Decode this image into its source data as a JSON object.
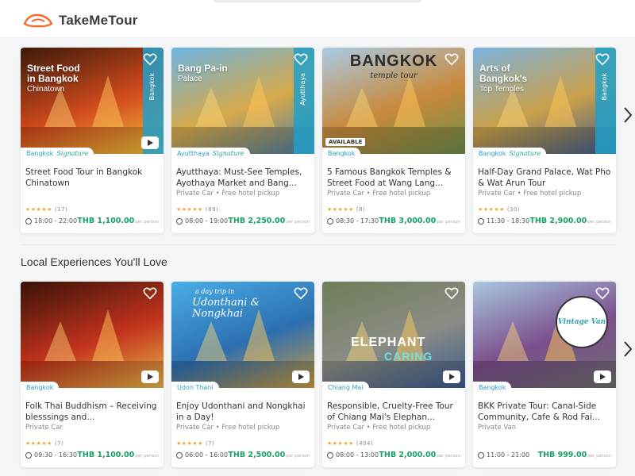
{
  "brand": {
    "name": "TakeMeTour"
  },
  "section2_title": "Local Experiences You'll Love",
  "per_person_label": "per person",
  "row1": [
    {
      "img_title_line1": "Street Food",
      "img_title_line2": "in Bangkok",
      "img_title_line3": "Chinatown",
      "band": "Bangkok",
      "location": "Bangkok",
      "signature": "Signature",
      "title": "Street Food Tour in Bangkok Chinatown",
      "transport": "",
      "stars": "★★★★★",
      "reviews": "(17)",
      "time": "18:00 - 22:00",
      "price": "THB 1,100.00",
      "colors": [
        "#3c1a0a",
        "#d24b1d",
        "#f3c43a"
      ]
    },
    {
      "img_title_line1": "Bang Pa-in",
      "img_title_line2": "",
      "img_title_line3": "Palace",
      "band": "Ayutthaya",
      "location": "Ayutthaya",
      "signature": "Signature",
      "title": "Ayutthaya: Must-See Temples, Ayothaya Market and Bang...",
      "transport": "Private Car • Free hotel pickup",
      "stars": "★★★★★",
      "reviews": "(89)",
      "time": "08:00 - 19:00",
      "price": "THB 2,250.00",
      "colors": [
        "#6bb5e3",
        "#d7a94a",
        "#4b7da3"
      ]
    },
    {
      "img_title_line1": "BANGKOK",
      "img_title_line2": "temple tour",
      "img_title_line3": "",
      "band": "",
      "location": "Bangkok",
      "signature": "",
      "title": "5 Famous Bangkok Temples & Street Food at Wang Lang...",
      "transport": "Private Car • Free hotel pickup",
      "stars": "★★★★★",
      "reviews": "(8)",
      "time": "08:30 - 17:30",
      "price": "THB 3,000.00",
      "badge": "AVAILABLE",
      "colors": [
        "#a9cbe6",
        "#c8893b",
        "#6b8f4a"
      ]
    },
    {
      "img_title_line1": "Arts of",
      "img_title_line2": "Bangkok's",
      "img_title_line3": "Top Temples",
      "band": "Bangkok",
      "location": "Bangkok",
      "signature": "Signature",
      "title": "Half-Day Grand Palace, Wat Pho & Wat Arun Tour",
      "transport": "Private Car • Free hotel pickup",
      "stars": "★★★★★",
      "reviews": "(30)",
      "time": "11:30 - 18:30",
      "price": "THB 2,900.00",
      "colors": [
        "#7db4df",
        "#caa04a",
        "#3a5b8a"
      ]
    }
  ],
  "row2": [
    {
      "location": "Bangkok",
      "title": "Folk Thai Buddhism – Receiving blesssings and...",
      "transport": "Private Car",
      "stars": "★★★★★",
      "reviews": "(7)",
      "time": "09:30 - 16:30",
      "price": "THB 1,100.00",
      "img_text": "",
      "img_text2": "",
      "colors": [
        "#3a1208",
        "#c2331d",
        "#e8b546"
      ]
    },
    {
      "location": "Udon Thani",
      "title": "Enjoy Udonthani and Nongkhai in a Day!",
      "transport": "Private Car • Free hotel pickup",
      "stars": "★★★★★",
      "reviews": "(7)",
      "time": "06:00 - 16:00",
      "price": "THB 2,500.00",
      "img_text": "a day trip in",
      "img_text2": "Udonthani & Nongkhai",
      "colors": [
        "#49aee6",
        "#2d6fb0",
        "#c99a42"
      ]
    },
    {
      "location": "Chiang Mai",
      "title": "Responsible, Cruelty-Free Tour of Chiang Mai's Elephan...",
      "transport": "Private Car • Free hotel pickup",
      "stars": "★★★★★",
      "reviews": "(404)",
      "time": "08:00 - 13:00",
      "price": "THB 2,000.00",
      "img_text": "ELEPHANT",
      "img_text2": "CARING",
      "colors": [
        "#6f7d58",
        "#8a8d86",
        "#3c5a8c"
      ]
    },
    {
      "location": "Bangkok",
      "title": "BKK Private Tour: Canal-Side Community, Cafe & Rod Fai...",
      "transport": "Private Van",
      "stars": "",
      "reviews": "",
      "time": "11:00 - 21:00",
      "price": "THB 999.00",
      "img_text": "Vintage Van",
      "img_text2": "",
      "colors": [
        "#a8c8e0",
        "#7b4e8c",
        "#6f6f6f"
      ]
    }
  ]
}
